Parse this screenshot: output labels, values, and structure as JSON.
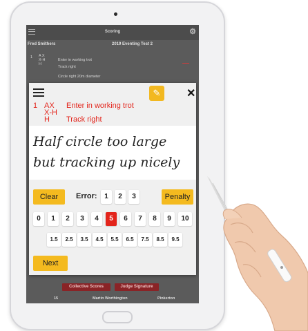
{
  "app": {
    "title": "Scoring",
    "rider": "Fred Smithers",
    "test": "2019 Eventing Test 2"
  },
  "background": {
    "rows": [
      {
        "num": "1",
        "marks": "A X\nX-H\nH",
        "text": "Enter in working trot\nTrack right"
      },
      {
        "num": "",
        "marks": "",
        "text": "Circle right 20m diameter"
      }
    ],
    "collective_label": "Collective Scores",
    "signature_label": "Judge Signature",
    "footer": {
      "num": "15",
      "judge": "Martin Worthington",
      "place": "Pinkerton"
    }
  },
  "dialog": {
    "movement_num": "1",
    "marks": [
      "AX",
      "X-H",
      "H"
    ],
    "descriptions": [
      "Enter in working trot",
      "Track right"
    ],
    "handwriting": [
      "Half circle too large",
      "but tracking up nicely"
    ],
    "clear_label": "Clear",
    "error_label": "Error:",
    "error_options": [
      "1",
      "2",
      "3"
    ],
    "penalty_label": "Penalty",
    "scores": [
      "0",
      "1",
      "2",
      "3",
      "4",
      "5",
      "6",
      "7",
      "8",
      "9",
      "10"
    ],
    "selected_score": "5",
    "half_scores": [
      "1.5",
      "2.5",
      "3.5",
      "4.5",
      "5.5",
      "6.5",
      "7.5",
      "8.5",
      "9.5"
    ],
    "next_label": "Next"
  },
  "colors": {
    "accent": "#f4ba1f",
    "selected": "#e3241b",
    "background_button": "#8a2326"
  },
  "icons": [
    "menu-icon",
    "settings-icon",
    "eraser-icon",
    "close-icon"
  ]
}
